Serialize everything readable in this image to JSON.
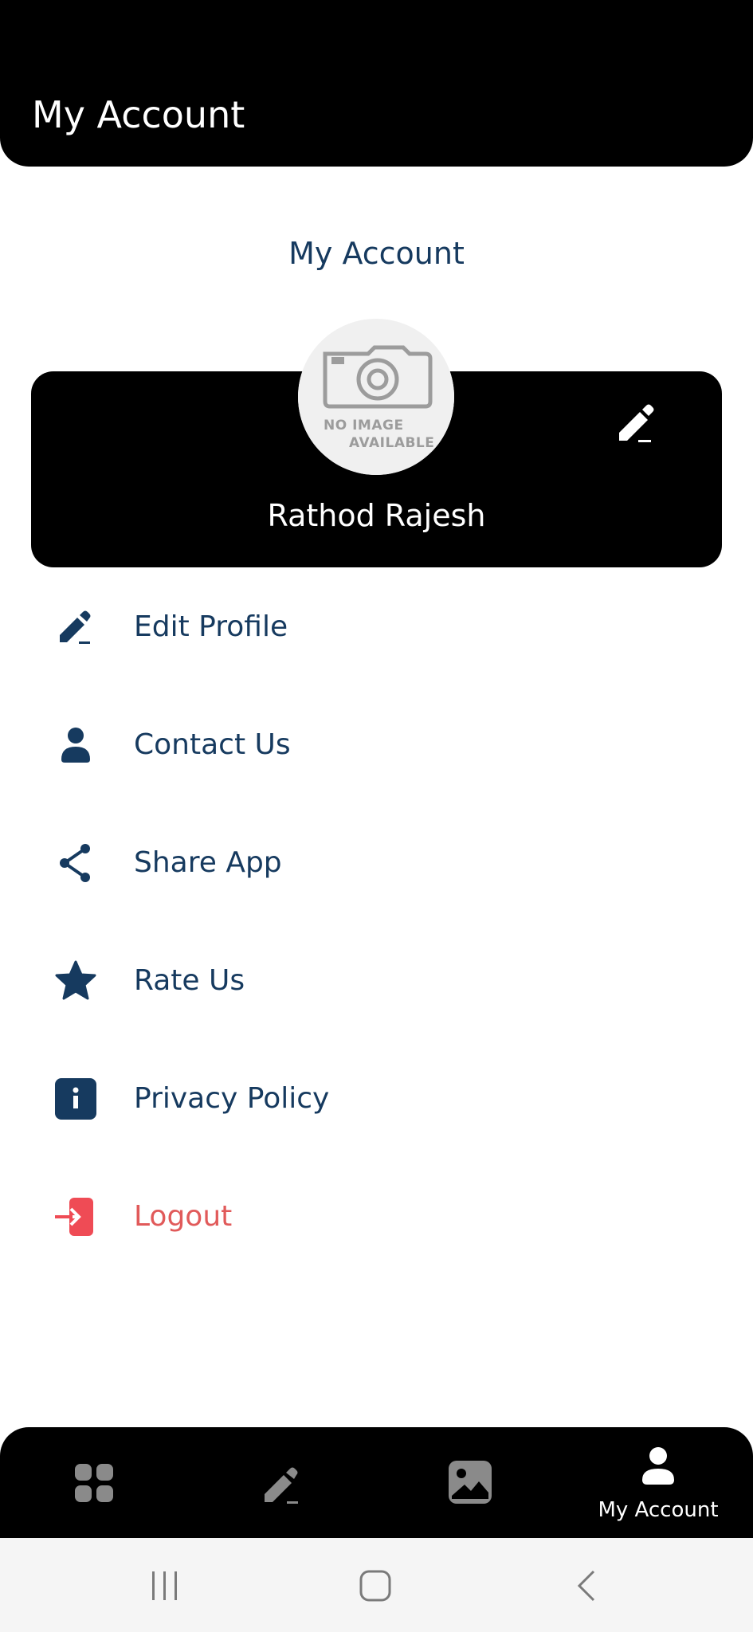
{
  "header": {
    "title": "My Account"
  },
  "page": {
    "section_title": "My Account"
  },
  "profile": {
    "name": "Rathod Rajesh",
    "avatar_text_line1": "NO IMAGE",
    "avatar_text_line2": "AVAILABLE",
    "edit_icon": "pencil-icon"
  },
  "menu": {
    "items": [
      {
        "label": "Edit Profile",
        "icon": "edit-icon"
      },
      {
        "label": "Contact Us",
        "icon": "person-icon"
      },
      {
        "label": "Share App",
        "icon": "share-icon"
      },
      {
        "label": "Rate Us",
        "icon": "star-icon"
      },
      {
        "label": "Privacy Policy",
        "icon": "info-icon"
      },
      {
        "label": "Logout",
        "icon": "logout-icon"
      }
    ]
  },
  "bottom_nav": {
    "items": [
      {
        "icon": "grid-icon",
        "label": ""
      },
      {
        "icon": "edit-icon",
        "label": ""
      },
      {
        "icon": "image-icon",
        "label": ""
      },
      {
        "icon": "person-icon",
        "label": "My Account",
        "active": true
      }
    ]
  },
  "colors": {
    "primary_text": "#163a5f",
    "logout": "#e15a5a",
    "header_bg": "#000000",
    "inactive_nav_icon": "#8a8a8a"
  }
}
